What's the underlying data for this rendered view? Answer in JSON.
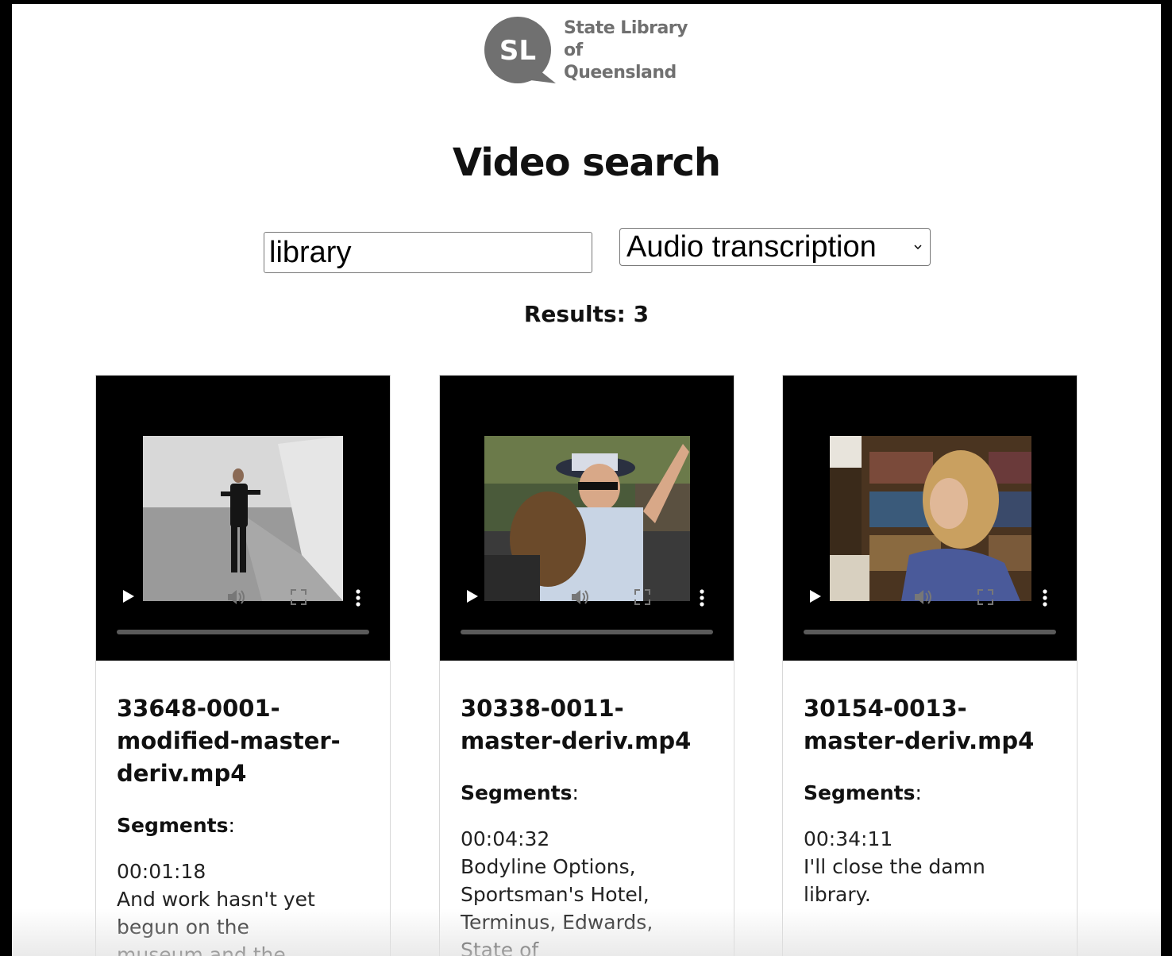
{
  "logo": {
    "mark": "SL",
    "line1": "State Library",
    "line2": "of Queensland",
    "color": "#707070"
  },
  "title": "Video search",
  "search": {
    "value": "library"
  },
  "filter": {
    "selected": "Audio transcription"
  },
  "results_label": "Results: 3",
  "segments_label": "Segments",
  "cards": [
    {
      "filename": "33648-0001-modified-master-deriv.mp4",
      "thumbnail": "man-in-suit-empty-hall",
      "segment_time": "00:01:18",
      "segment_text": "And work hasn't yet begun on the museum and the State Library."
    },
    {
      "filename": "30338-0011-master-deriv.mp4",
      "thumbnail": "police-officers-crowd",
      "segment_time": "00:04:32",
      "segment_text": "Bodyline Options, Sportsman's Hotel, Terminus, Edwards, State of"
    },
    {
      "filename": "30154-0013-master-deriv.mp4",
      "thumbnail": "woman-in-front-of-bookshelf",
      "segment_time": "00:34:11",
      "segment_text": "I'll close the damn library."
    }
  ]
}
